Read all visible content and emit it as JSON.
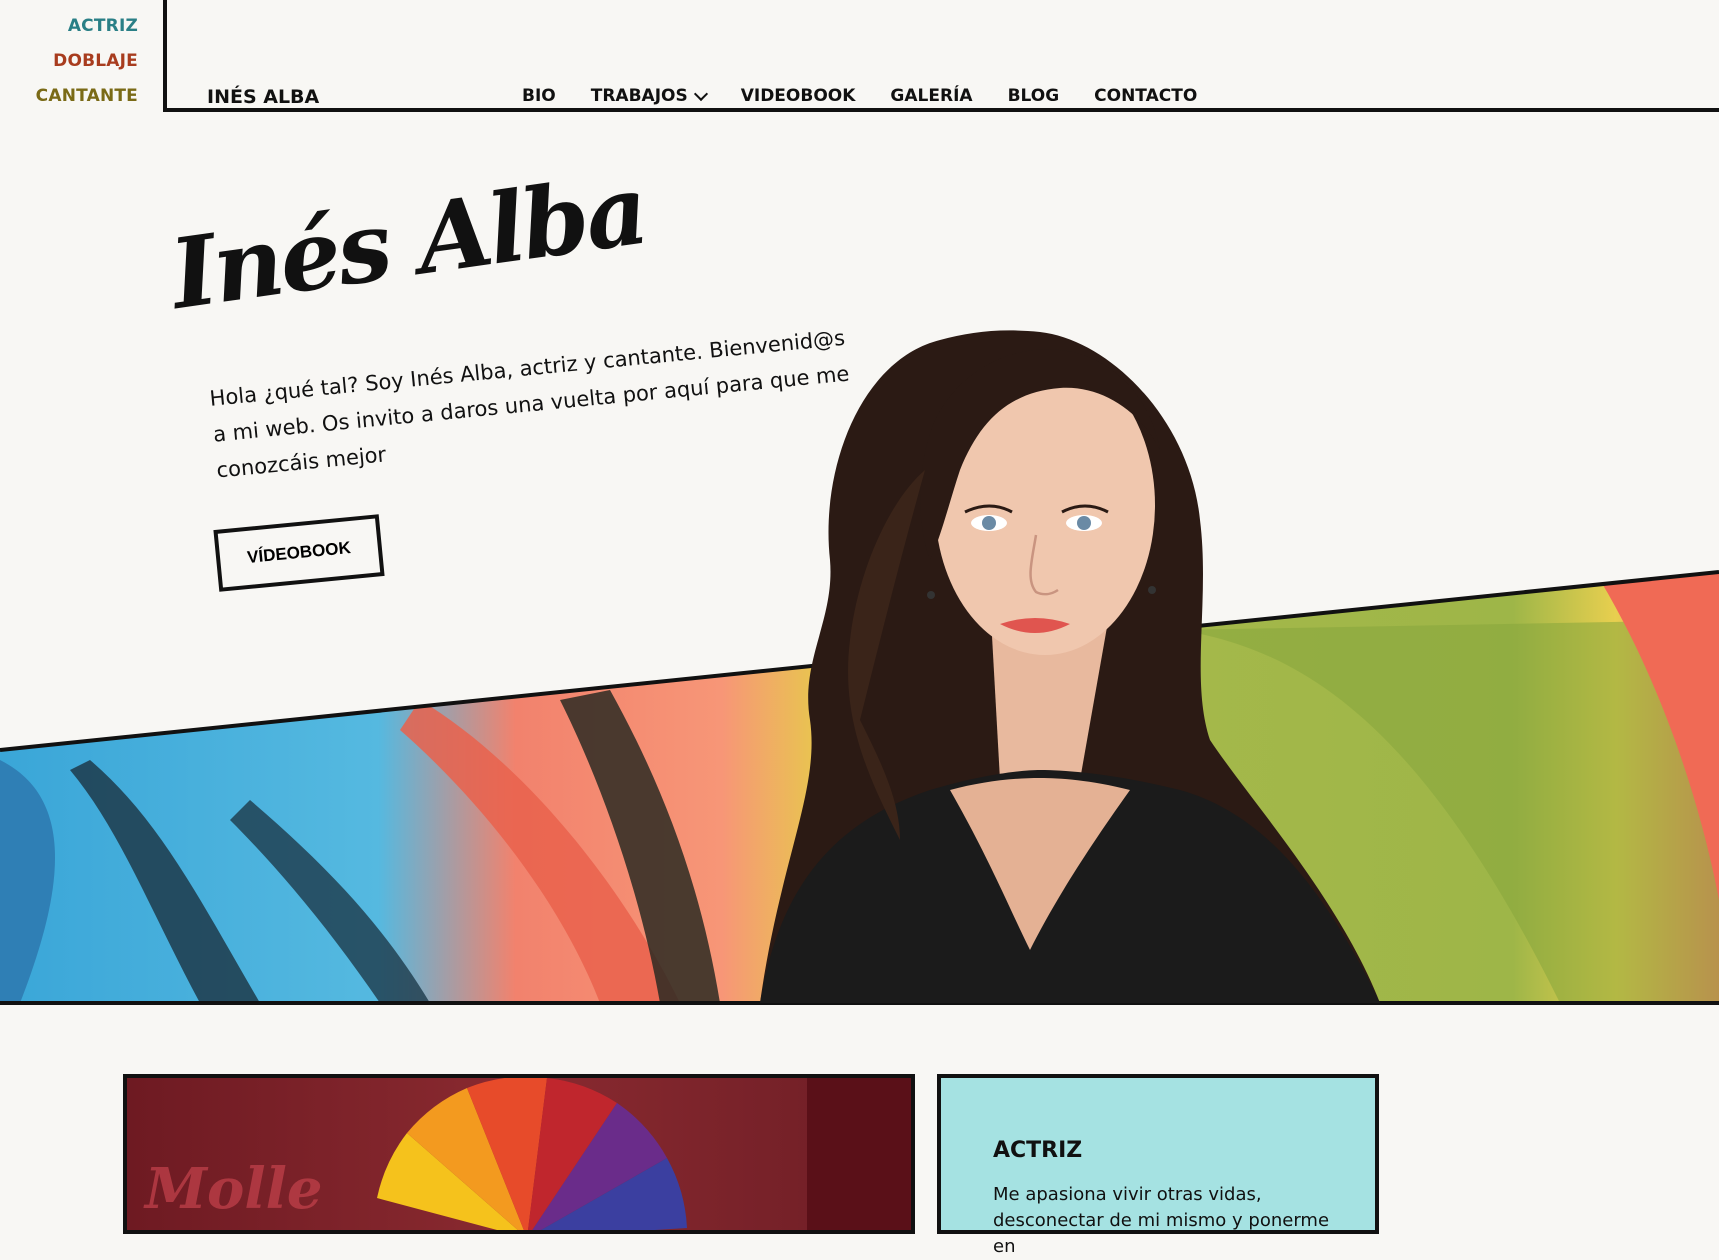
{
  "roles": {
    "actriz": "ACTRIZ",
    "doblaje": "DOBLAJE",
    "cantante": "CANTANTE"
  },
  "header": {
    "brand": "INÉS ALBA",
    "nav": {
      "bio": "BIO",
      "trabajos": "TRABAJOS",
      "videobook": "VIDEOBOOK",
      "galeria": "GALERÍA",
      "blog": "BLOG",
      "contacto": "CONTACTO"
    }
  },
  "hero": {
    "signature": "Inés Alba",
    "intro": "Hola ¿qué tal? Soy Inés Alba, actriz y cantante. Bienvenid@s a mi web. Os invito a daros una vuelta por aquí para que me conozcáis mejor",
    "button": "VÍDEOBOOK"
  },
  "cards": {
    "photo_text": "Molle",
    "actriz_title": "ACTRIZ",
    "actriz_body": "Me apasiona vivir otras vidas, desconectar de mi mismo y ponerme en"
  },
  "colors": {
    "actriz": "#2a7f86",
    "doblaje": "#a83c1e",
    "cantante": "#7a6a16",
    "card_bg": "#a5e2e2",
    "page_bg": "#f8f7f4"
  }
}
